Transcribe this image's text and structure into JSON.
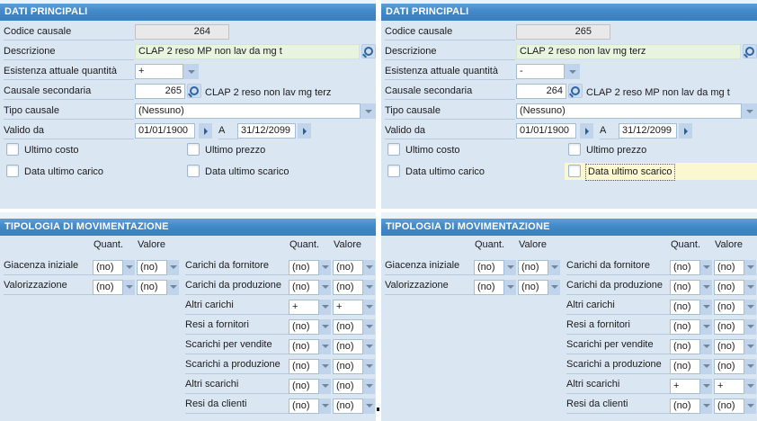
{
  "colors": {
    "header_blue": "#4289c8",
    "panel_bg": "#dbe6f3",
    "field_green": "#e8f4df",
    "field_gray": "#e9e9e9",
    "highlight_yellow": "#fbf7d0",
    "dropdown_button": "#c0d5eb",
    "accent_dark_blue": "#2b5d9b"
  },
  "panels": [
    {
      "dati": {
        "title": "DATI PRINCIPALI",
        "codice": {
          "label": "Codice causale",
          "value": "264"
        },
        "descrizione": {
          "label": "Descrizione",
          "value": "CLAP 2 reso MP non lav da mg t"
        },
        "esistenza": {
          "label": "Esistenza attuale quantità",
          "value": "+"
        },
        "causale_secondaria": {
          "label": "Causale secondaria",
          "value": "265",
          "descrizione": "CLAP 2 reso non lav mg terz"
        },
        "tipo_causale": {
          "label": "Tipo causale",
          "value": "(Nessuno)"
        },
        "validita": {
          "label": "Valido da",
          "da": "01/01/1900",
          "a_label": "A",
          "a": "31/12/2099"
        },
        "check_ultimo_costo": "Ultimo costo",
        "check_ultimo_prezzo": "Ultimo prezzo",
        "check_data_ultimo_carico": "Data ultimo carico",
        "check_data_ultimo_scarico": "Data ultimo scarico"
      },
      "tipologia": {
        "title": "TIPOLOGIA DI MOVIMENTAZIONE",
        "quant_header": "Quant.",
        "valore_header": "Valore",
        "group1": [
          {
            "label": "Giacenza iniziale",
            "q": "(no)",
            "v": "(no)"
          },
          {
            "label": "Valorizzazione",
            "q": "(no)",
            "v": "(no)"
          }
        ],
        "group2": [
          {
            "label": "Carichi da fornitore",
            "q": "(no)",
            "v": "(no)"
          },
          {
            "label": "Carichi da produzione",
            "q": "(no)",
            "v": "(no)"
          },
          {
            "label": "Altri carichi",
            "q": "+",
            "v": "+"
          },
          {
            "label": "Resi a fornitori",
            "q": "(no)",
            "v": "(no)"
          },
          {
            "label": "Scarichi per vendite",
            "q": "(no)",
            "v": "(no)"
          },
          {
            "label": "Scarichi a produzione",
            "q": "(no)",
            "v": "(no)"
          },
          {
            "label": "Altri scarichi",
            "q": "(no)",
            "v": "(no)"
          },
          {
            "label": "Resi da clienti",
            "q": "(no)",
            "v": "(no)"
          }
        ]
      }
    },
    {
      "dati": {
        "title": "DATI PRINCIPALI",
        "codice": {
          "label": "Codice causale",
          "value": "265"
        },
        "descrizione": {
          "label": "Descrizione",
          "value": "CLAP 2 reso non lav mg terz"
        },
        "esistenza": {
          "label": "Esistenza attuale quantità",
          "value": "-"
        },
        "causale_secondaria": {
          "label": "Causale secondaria",
          "value": "264",
          "descrizione": "CLAP 2 reso MP non lav da mg t"
        },
        "tipo_causale": {
          "label": "Tipo causale",
          "value": "(Nessuno)"
        },
        "validita": {
          "label": "Valido da",
          "da": "01/01/1900",
          "a_label": "A",
          "a": "31/12/2099"
        },
        "check_ultimo_costo": "Ultimo costo",
        "check_ultimo_prezzo": "Ultimo prezzo",
        "check_data_ultimo_carico": "Data ultimo carico",
        "check_data_ultimo_scarico": "Data ultimo scarico"
      },
      "tipologia": {
        "title": "TIPOLOGIA DI MOVIMENTAZIONE",
        "quant_header": "Quant.",
        "valore_header": "Valore",
        "group1": [
          {
            "label": "Giacenza iniziale",
            "q": "(no)",
            "v": "(no)"
          },
          {
            "label": "Valorizzazione",
            "q": "(no)",
            "v": "(no)"
          }
        ],
        "group2": [
          {
            "label": "Carichi da fornitore",
            "q": "(no)",
            "v": "(no)"
          },
          {
            "label": "Carichi da produzione",
            "q": "(no)",
            "v": "(no)"
          },
          {
            "label": "Altri carichi",
            "q": "(no)",
            "v": "(no)"
          },
          {
            "label": "Resi a fornitori",
            "q": "(no)",
            "v": "(no)"
          },
          {
            "label": "Scarichi per vendite",
            "q": "(no)",
            "v": "(no)"
          },
          {
            "label": "Scarichi a produzione",
            "q": "(no)",
            "v": "(no)"
          },
          {
            "label": "Altri scarichi",
            "q": "+",
            "v": "+"
          },
          {
            "label": "Resi da clienti",
            "q": "(no)",
            "v": "(no)"
          }
        ]
      }
    }
  ]
}
